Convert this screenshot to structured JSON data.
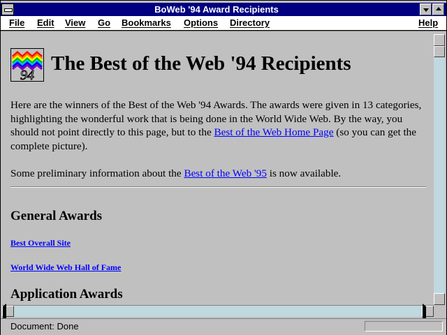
{
  "window": {
    "title": "BoWeb '94 Award Recipients"
  },
  "menubar": {
    "items": [
      "File",
      "Edit",
      "View",
      "Go",
      "Bookmarks",
      "Options",
      "Directory"
    ],
    "help": "Help"
  },
  "page": {
    "logo_text": "94",
    "heading": "The Best of the Web '94 Recipients",
    "intro_text": "Here are the winners of the Best of the Web '94 Awards. The awards were given in 13 categories, highlighting the wonderful work that is being done in the World Wide Web. By the way, you should not point directly to this page, but to the ",
    "intro_link": "Best of the Web Home Page",
    "intro_after": " (so you can get the complete picture).",
    "prelim_before": "Some preliminary information about the ",
    "prelim_link": "Best of the Web '95",
    "prelim_after": " is now available.",
    "sections": [
      {
        "title": "General Awards",
        "links": [
          "Best Overall Site",
          "World Wide Web Hall of Fame"
        ]
      },
      {
        "title": "Application Awards",
        "links": []
      }
    ]
  },
  "status": {
    "text": "Document: Done"
  },
  "colors": {
    "titlebar": "#000080",
    "page_background": "#c0c0c0",
    "link": "#0000ff",
    "scroll_track": "#c0d8e0"
  },
  "icons": {
    "system_menu": "system-menu-icon",
    "minimize": "minimize-icon",
    "maximize": "maximize-icon",
    "logo": "best-of-web-94-logo"
  }
}
